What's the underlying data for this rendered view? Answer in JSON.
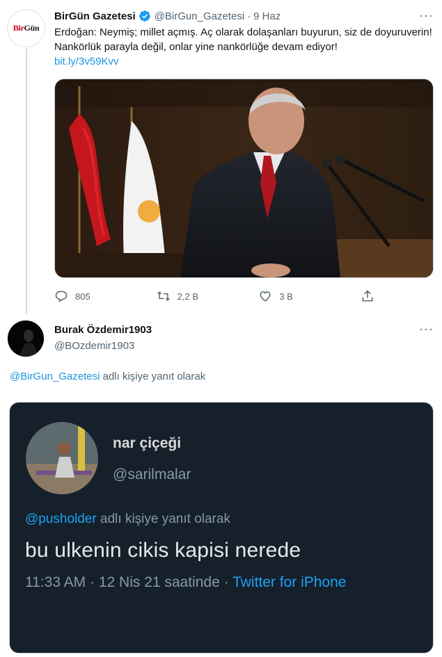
{
  "tweet1": {
    "avatar_logo": {
      "part1": "Bir",
      "part2": "Gün"
    },
    "name": "BirGün Gazetesi",
    "handle": "@BirGun_Gazetesi",
    "separator": "·",
    "date": "9 Haz",
    "text": "Erdoğan: Neymiş; millet açmış. Aç olarak dolaşanları buyurun, siz de doyuruverin! Nankörlük parayla değil, onlar yine nankörlüğe devam ediyor!",
    "link": "bit.ly/3v59Kvv",
    "stats": {
      "replies": "805",
      "retweets": "2,2 B",
      "likes": "3 B"
    }
  },
  "tweet2": {
    "name": "Burak Özdemir1903",
    "handle": "@BOzdemir1903",
    "reply_mention": "@BirGun_Gazetesi",
    "reply_suffix": " adlı kişiye yanıt olarak",
    "embedded": {
      "name": "nar çiçeği",
      "handle": "@sarilmalar",
      "reply_mention": "@pusholder",
      "reply_suffix": " adlı kişiye yanıt olarak",
      "text": "bu ulkenin cikis kapisi nerede",
      "meta": "11:33 AM · 12 Nis 21 saatinde · ",
      "source": "Twitter for iPhone"
    }
  },
  "icons": {
    "more": "more-icon",
    "verified": "verified-badge-icon",
    "reply": "reply-icon",
    "retweet": "retweet-icon",
    "like": "like-icon",
    "share": "share-icon"
  },
  "colors": {
    "link": "#1b95e0",
    "muted": "#536471",
    "embed_bg": "#15202b",
    "verified": "#1d9bf0"
  },
  "more_glyph": "···"
}
